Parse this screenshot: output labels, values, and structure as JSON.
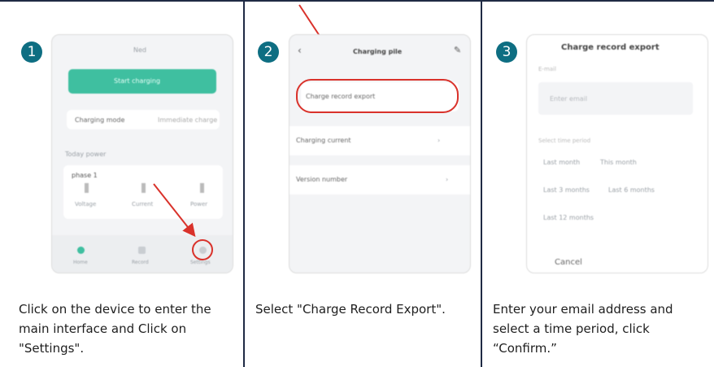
{
  "steps": [
    {
      "number": "1",
      "caption": "Click on the device to enter the main interface and Click on \"Settings\".",
      "screen": {
        "title": "Ned",
        "start_button": "Start charging",
        "mode_label": "Charging mode",
        "mode_value": "Immediate charge",
        "today_label": "Today power",
        "card_title": "phase 1",
        "stats": [
          "Voltage",
          "Current",
          "Power"
        ],
        "nav": [
          "Home",
          "Record",
          "Settings"
        ]
      }
    },
    {
      "number": "2",
      "caption": "Select \"Charge Record Export\".",
      "screen": {
        "title": "Charging pile",
        "items": [
          "Charge record export",
          "Charging current",
          "Version number"
        ]
      }
    },
    {
      "number": "3",
      "caption": "Enter your email address and select a time period, click “Confirm.”",
      "screen": {
        "title": "Charge record export",
        "email_label": "E-mail",
        "email_placeholder": "Enter email",
        "period_label": "Select time period",
        "periods": [
          "Last month",
          "This month",
          "Last 3 months",
          "Last 6 months",
          "Last 12 months"
        ],
        "cancel": "Cancel"
      }
    }
  ],
  "colors": {
    "accent": "#0e6e82",
    "highlight": "#d9322b",
    "teal_button": "#3fbfa0",
    "divider": "#1f2a44"
  }
}
